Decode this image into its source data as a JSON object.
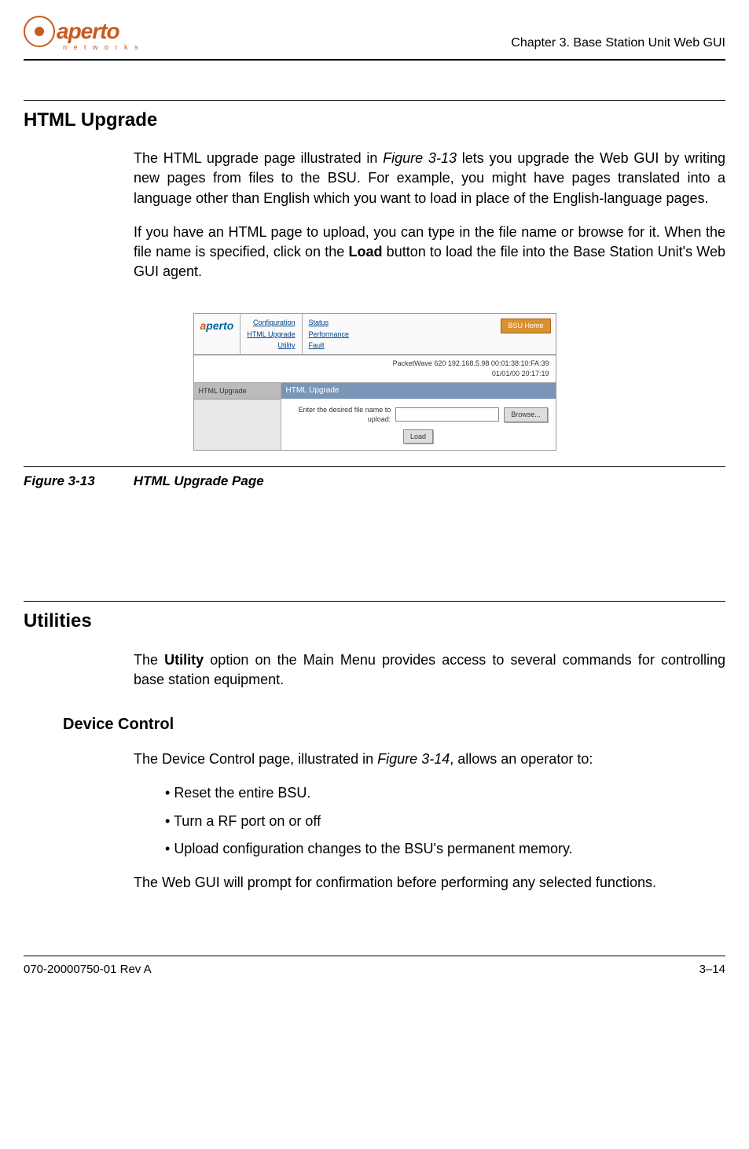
{
  "header": {
    "logo_text1": "aperto",
    "logo_sub": "n e t w o r k s",
    "chapter": "Chapter 3.  Base Station Unit Web GUI"
  },
  "section1": {
    "title": "HTML Upgrade",
    "para1a": "The HTML upgrade page illustrated in ",
    "fig_ref": "Figure 3-13",
    "para1b": " lets you upgrade the Web GUI by writing new pages from files to the BSU. For example, you might have pages translated into a language other than English which you want to load in place of the English-language pages.",
    "para2a": "If you have an HTML page to upload, you can type in the file name or browse for it. When the file name is specified, click on the ",
    "bold_load": "Load",
    "para2b": " button to load the file into the Base Station Unit's Web GUI agent."
  },
  "screenshot": {
    "nav1": {
      "a": "Configuration",
      "b": "HTML Upgrade",
      "c": "Utility"
    },
    "nav2": {
      "a": "Status",
      "b": "Performance",
      "c": "Fault"
    },
    "bsu_home": "BSU Home",
    "status_line1": "PacketWave 620    192.168.5.98    00:01:38:10:FA:39",
    "status_line2": "01/01/00    20:17:19",
    "sidebar_item": "HTML Upgrade",
    "panel_title": "HTML Upgrade",
    "form_label": "Enter the desired file name to upload:",
    "browse": "Browse...",
    "load": "Load"
  },
  "figure_caption": {
    "num": "Figure 3-13",
    "title": "HTML Upgrade Page"
  },
  "section2": {
    "title": "Utilities",
    "para1a": "The ",
    "bold_utility": "Utility",
    "para1b": " option on the Main Menu provides access to several commands for controlling base station equipment.",
    "sub_title": "Device Control",
    "para2a": "The Device Control page, illustrated in ",
    "fig_ref": "Figure 3-14",
    "para2b": ", allows an operator to:",
    "bullets": [
      "Reset the entire BSU.",
      "Turn a RF port on or off",
      "Upload configuration changes to the BSU's permanent memory."
    ],
    "para3": "The Web GUI will prompt for confirmation before performing any selected functions."
  },
  "footer": {
    "left": "070-20000750-01 Rev A",
    "right": "3–14"
  }
}
